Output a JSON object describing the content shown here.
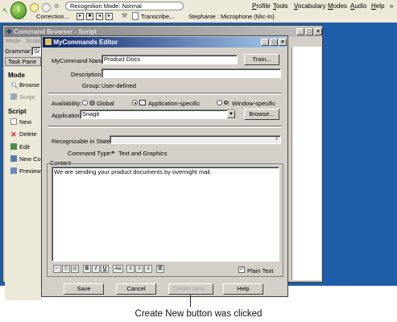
{
  "dragonbar": {
    "recognition_mode": "Recognition Mode: Normal",
    "correction_label": "Correction...",
    "transcribe_label": "Transcribe...",
    "microphone_status": "Stephanie : Microphone (Mic-In)",
    "menu": [
      "Profile",
      "Tools",
      "Vocabulary",
      "Modes",
      "Audio",
      "Help"
    ],
    "menu_underline": [
      "P",
      "T",
      "V",
      "M",
      "A",
      "H"
    ],
    "chevron": "»"
  },
  "command_browser": {
    "title": "Command Browser - Script",
    "menu": [
      "Mode",
      "Script"
    ],
    "grammar_label": "Grammar:",
    "grammar_value": "Sn",
    "task_pane_label": "Task Pane",
    "mode_header": "Mode",
    "browse": "Browse",
    "script_mode": "Script",
    "script_header": "Script",
    "new": "New",
    "delete": "Delete",
    "edit": "Edit",
    "new_copy": "New Cop",
    "preview": "Preview"
  },
  "editor": {
    "title": "MyCommands Editor",
    "mycommand_name_label": "MyCommand Name:",
    "mycommand_name_value": "Product Docs",
    "train_button": "Train...",
    "description_label": "Description:",
    "description_value": "",
    "group_label": "Group:",
    "group_value": "User-defined",
    "availability_label": "Availability:",
    "availability_options": [
      "Global",
      "Application-specific",
      "Window-specific"
    ],
    "availability_selected": "Application-specific",
    "application_label": "Application:",
    "application_value": "Snagit",
    "browse_button": "Browse...",
    "recognizable_label": "Recognizable in States:",
    "recognizable_value": "",
    "command_type_label": "Command Type:",
    "command_type_value": "Text and Graphics",
    "content_label": "Content",
    "content_text": "We are sending your product documents by overnight mail.",
    "plain_text_label": "Plain Text",
    "plain_text_checked": true,
    "format_buttons": [
      "B",
      "I",
      "U",
      "Aa"
    ],
    "save_button": "Save",
    "cancel_button": "Cancel",
    "create_new_button": "Create New...",
    "help_button": "Help"
  },
  "caption": "Create New button was clicked",
  "colors": {
    "desktop": "#1f5ea8",
    "titlebar_active": "#0a246a",
    "titlebar_inactive": "#808080",
    "dialog_face": "#d4d0c8"
  }
}
